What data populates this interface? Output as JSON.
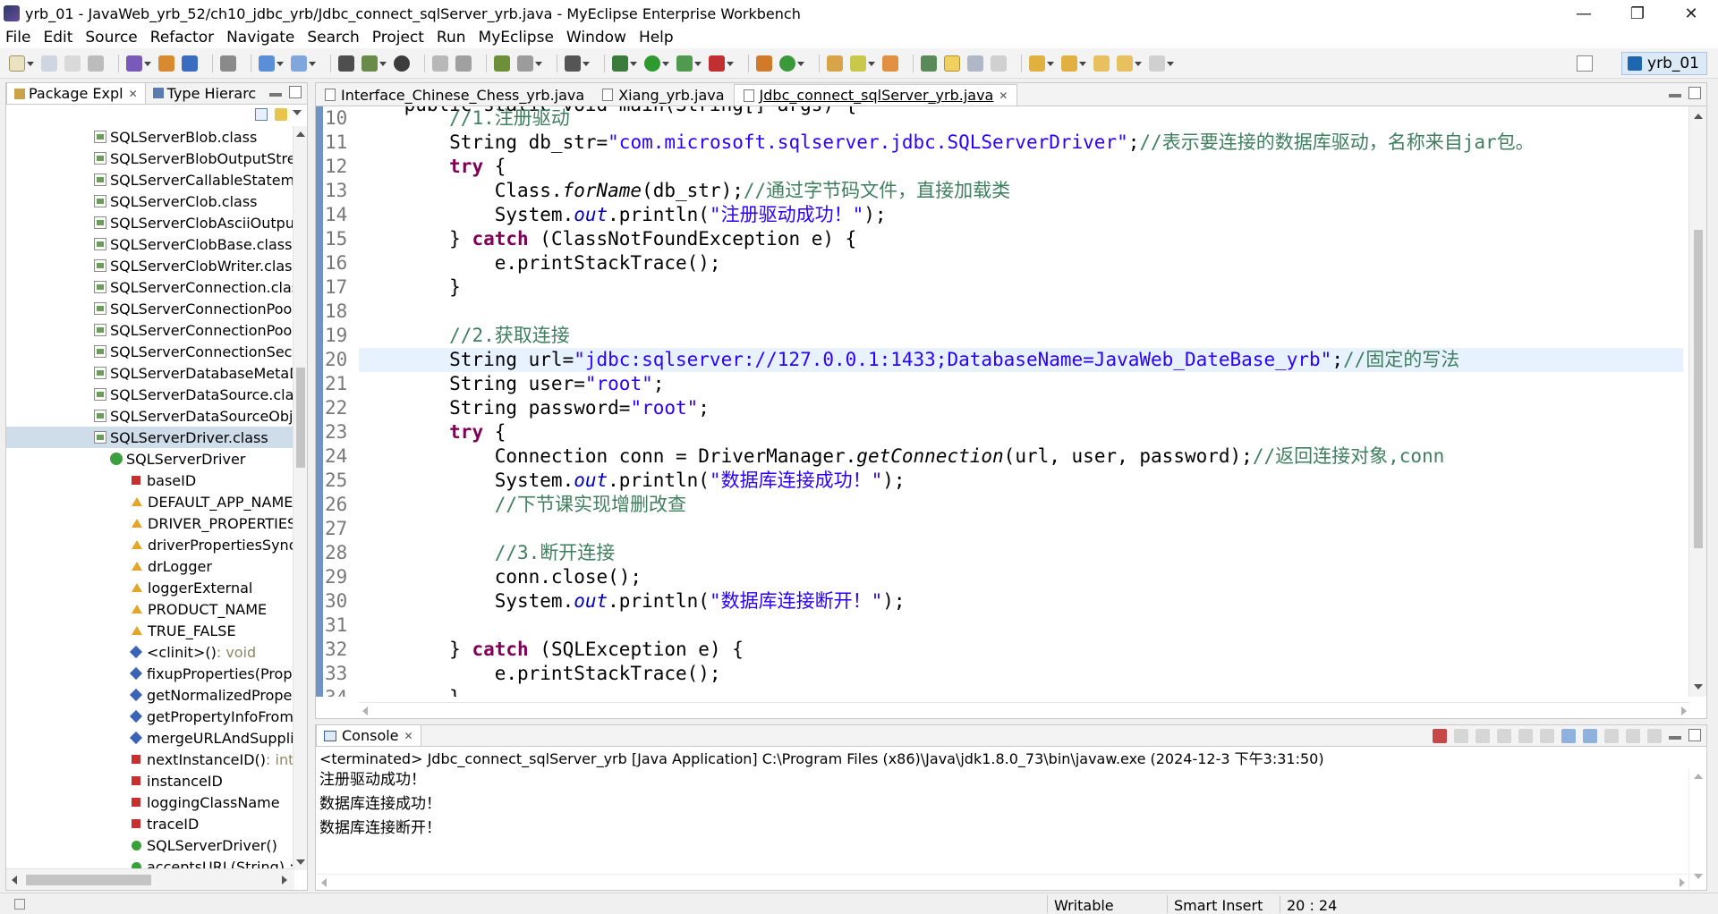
{
  "window": {
    "title": "yrb_01 - JavaWeb_yrb_52/ch10_jdbc_yrb/Jdbc_connect_sqlServer_yrb.java - MyEclipse Enterprise Workbench",
    "minimize": "—",
    "restore": "❐",
    "close": "✕"
  },
  "menu": [
    "File",
    "Edit",
    "Source",
    "Refactor",
    "Navigate",
    "Search",
    "Project",
    "Run",
    "MyEclipse",
    "Window",
    "Help"
  ],
  "perspective": {
    "label": "yrb_01"
  },
  "left_panel": {
    "tabs": [
      {
        "label": "Package Expl",
        "close": "✕"
      },
      {
        "label": "Type Hierarc"
      }
    ],
    "tree": [
      {
        "label": "SQLServerBlob.class",
        "icon": "class-file-icon",
        "indent": 1
      },
      {
        "label": "SQLServerBlobOutputStrea",
        "icon": "class-file-icon",
        "indent": 1
      },
      {
        "label": "SQLServerCallableStateme",
        "icon": "class-file-icon",
        "indent": 1
      },
      {
        "label": "SQLServerClob.class",
        "icon": "class-file-icon",
        "indent": 1
      },
      {
        "label": "SQLServerClobAsciiOutput",
        "icon": "class-file-icon",
        "indent": 1
      },
      {
        "label": "SQLServerClobBase.class",
        "icon": "class-file-icon",
        "indent": 1
      },
      {
        "label": "SQLServerClobWriter.class",
        "icon": "class-file-icon",
        "indent": 1
      },
      {
        "label": "SQLServerConnection.clas",
        "icon": "class-file-icon",
        "indent": 1
      },
      {
        "label": "SQLServerConnectionPool",
        "icon": "class-file-icon",
        "indent": 1
      },
      {
        "label": "SQLServerConnectionPool",
        "icon": "class-file-icon",
        "indent": 1
      },
      {
        "label": "SQLServerConnectionSecu",
        "icon": "class-file-icon",
        "indent": 1
      },
      {
        "label": "SQLServerDatabaseMetaD",
        "icon": "class-file-icon",
        "indent": 1
      },
      {
        "label": "SQLServerDataSource.clas",
        "icon": "class-file-icon",
        "indent": 1
      },
      {
        "label": "SQLServerDataSourceObje",
        "icon": "class-file-icon",
        "indent": 1
      },
      {
        "label": "SQLServerDriver.class",
        "icon": "class-file-icon",
        "indent": 1,
        "selected": true
      },
      {
        "label": "SQLServerDriver",
        "icon": "class-icon",
        "indent": 2
      },
      {
        "label": "baseID",
        "icon": "private-static-field-icon",
        "indent": 3
      },
      {
        "label": "DEFAULT_APP_NAME",
        "icon": "static-final-field-icon",
        "indent": 3
      },
      {
        "label": "DRIVER_PROPERTIES",
        "icon": "static-final-field-icon",
        "indent": 3
      },
      {
        "label": "driverPropertiesSynor",
        "icon": "static-final-field-icon",
        "indent": 3
      },
      {
        "label": "drLogger",
        "icon": "static-final-field-icon",
        "indent": 3
      },
      {
        "label": "loggerExternal",
        "icon": "static-final-field-icon",
        "indent": 3
      },
      {
        "label": "PRODUCT_NAME",
        "icon": "static-final-field-icon",
        "indent": 3
      },
      {
        "label": "TRUE_FALSE",
        "icon": "static-final-field-icon",
        "indent": 3
      },
      {
        "label": "<clinit>()",
        "suffix": " : void",
        "icon": "static-init-icon",
        "indent": 3
      },
      {
        "label": "fixupProperties(Prope",
        "icon": "static-method-icon",
        "indent": 3
      },
      {
        "label": "getNormalizedProper",
        "icon": "static-method-icon",
        "indent": 3
      },
      {
        "label": "getPropertyInfoFrom",
        "icon": "static-method-icon",
        "indent": 3
      },
      {
        "label": "mergeURLAndSupplie",
        "icon": "static-method-icon",
        "indent": 3
      },
      {
        "label": "nextInstanceID()",
        "suffix": " : int",
        "icon": "private-static-method-icon",
        "indent": 3
      },
      {
        "label": "instanceID",
        "icon": "private-field-icon",
        "indent": 3
      },
      {
        "label": "loggingClassName",
        "icon": "private-field-icon",
        "indent": 3
      },
      {
        "label": "traceID",
        "icon": "private-field-icon",
        "indent": 3
      },
      {
        "label": "SQLServerDriver()",
        "icon": "constructor-icon",
        "indent": 3
      },
      {
        "label": "acceptsURL(String) : b",
        "icon": "public-method-icon",
        "indent": 3
      }
    ]
  },
  "editor": {
    "tabs": [
      {
        "label": "Interface_Chinese_Chess_yrb.java"
      },
      {
        "label": "Xiang_yrb.java"
      },
      {
        "label": "Jdbc_connect_sqlServer_yrb.java",
        "active": true,
        "close": "✕"
      }
    ],
    "top_partial": "    public static void main(String[] args) {",
    "line_numbers": [
      "10",
      "11",
      "12",
      "13",
      "14",
      "15",
      "16",
      "17",
      "18",
      "19",
      "20",
      "21",
      "22",
      "23",
      "24",
      "25",
      "26",
      "27",
      "28",
      "29",
      "30",
      "31",
      "32",
      "33",
      "34"
    ],
    "lines": [
      "        //1.注册驱动",
      "        String db_str=\"com.microsoft.sqlserver.jdbc.SQLServerDriver\";//表示要连接的数据库驱动，名称来自jar包。",
      "        try {",
      "            Class.forName(db_str);//通过字节码文件，直接加载类",
      "            System.out.println(\"注册驱动成功！\");",
      "        } catch (ClassNotFoundException e) {",
      "            e.printStackTrace();",
      "        }",
      "",
      "        //2.获取连接",
      "        String url=\"jdbc:sqlserver://127.0.0.1:1433;DatabaseName=JavaWeb_DateBase_yrb\";//固定的写法",
      "        String user=\"root\";",
      "        String password=\"root\";",
      "        try {",
      "            Connection conn = DriverManager.getConnection(url, user, password);//返回连接对象,conn",
      "            System.out.println(\"数据库连接成功！\");",
      "            //下节课实现增删改查",
      "",
      "            //3.断开连接",
      "            conn.close();",
      "            System.out.println(\"数据库连接断开！\");",
      "",
      "        } catch (SQLException e) {",
      "            e.printStackTrace();",
      "        }"
    ],
    "current_line": "20"
  },
  "console": {
    "tab_label": "Console",
    "close": "✕",
    "status": "<terminated> Jdbc_connect_sqlServer_yrb [Java Application] C:\\Program Files (x86)\\Java\\jdk1.8.0_73\\bin\\javaw.exe (2024-12-3 下午3:31:50)",
    "output": [
      "注册驱动成功！",
      "数据库连接成功！",
      "数据库连接断开！"
    ]
  },
  "statusbar": {
    "writable": "Writable",
    "insert_mode": "Smart Insert",
    "position": "20 : 24"
  },
  "colors": {
    "keyword": "#7f0055",
    "string": "#2a00ff",
    "comment": "#3f7f5f",
    "field": "#0000c0",
    "current_line": "#e8f2fe",
    "selection": "#cfdcea"
  }
}
